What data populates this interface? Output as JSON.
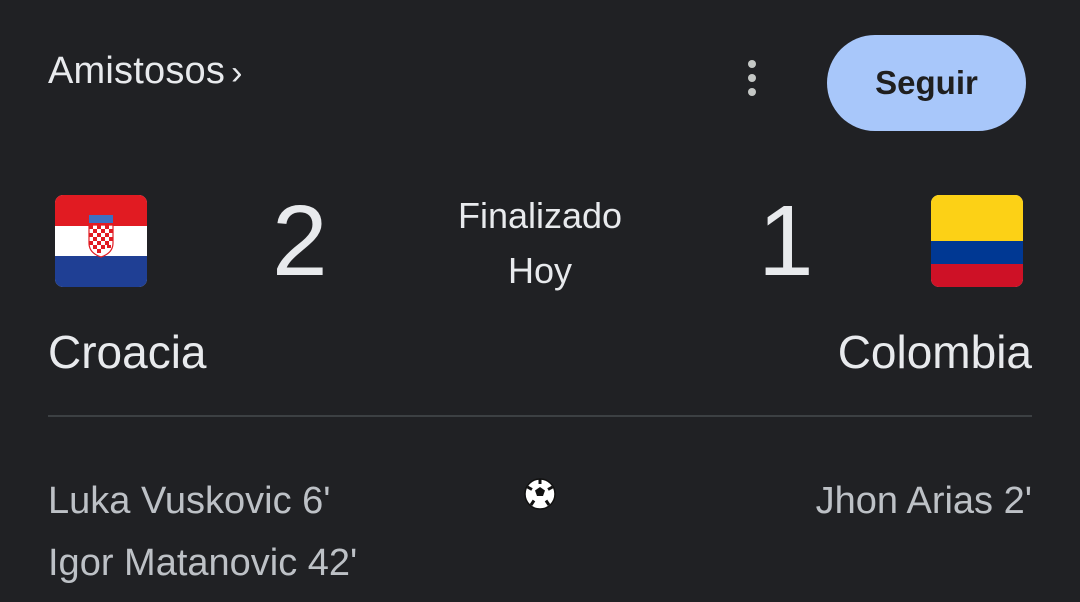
{
  "header": {
    "competition": "Amistosos",
    "chevron": "›",
    "more_icon": "more-vert-icon",
    "follow_label": "Seguir"
  },
  "colors": {
    "background": "#202124",
    "button_bg": "#a8c7fa",
    "divider": "#3c4043"
  },
  "match": {
    "status": "Finalizado",
    "date": "Hoy",
    "home": {
      "name": "Croacia",
      "score": "2",
      "flag_icon": "croatia-flag-icon",
      "scorers": [
        "Luka Vuskovic 6'",
        "Igor Matanovic 42'"
      ]
    },
    "away": {
      "name": "Colombia",
      "score": "1",
      "flag_icon": "colombia-flag-icon",
      "scorers": [
        "Jhon Arias 2'"
      ]
    },
    "goal_icon": "soccer-ball-icon"
  }
}
